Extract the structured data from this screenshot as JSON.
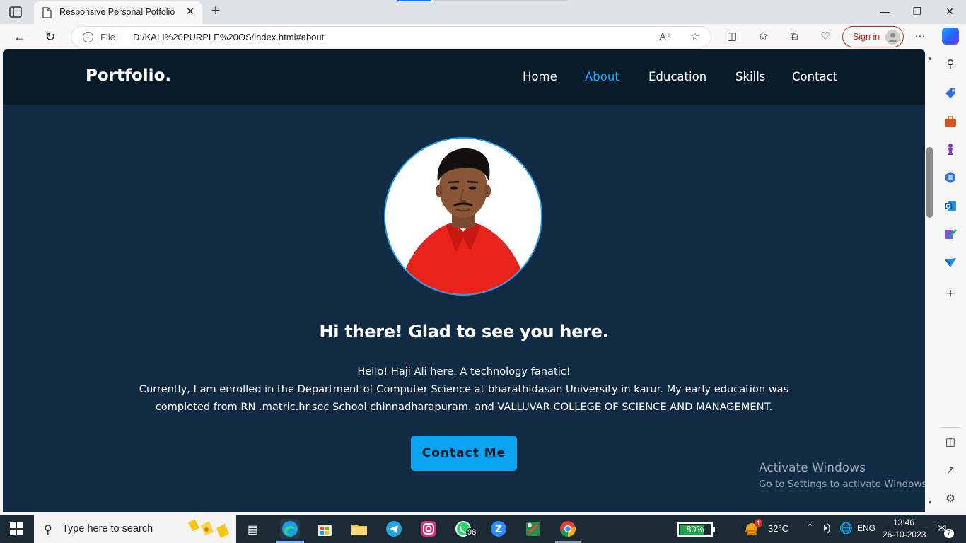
{
  "browser": {
    "tab_title": "Responsive Personal Potfolio",
    "tab_close": "✕",
    "new_tab": "+",
    "window_minimize": "—",
    "window_restore": "❐",
    "window_close": "✕",
    "address_scheme_label": "File",
    "url": "D:/KALI%20PURPLE%20OS/index.html#about",
    "sign_in_label": "Sign in",
    "more_menu": "⋯"
  },
  "site": {
    "logo": "Portfolio.",
    "nav": [
      {
        "label": "Home",
        "active": false
      },
      {
        "label": "About",
        "active": true
      },
      {
        "label": "Education",
        "active": false
      },
      {
        "label": "Skills",
        "active": false
      },
      {
        "label": "Contact",
        "active": false
      }
    ],
    "headline": "Hi there! Glad to see you here.",
    "intro_lines": [
      "Hello! Haji Ali here. A technology fanatic!",
      "Currently, I am enrolled in the Department of Computer Science at bharathidasan University in karur. My early education was",
      "completed from RN .matric.hr.sec School chinnadharapuram. and VALLUVAR COLLEGE OF SCIENCE AND MANAGEMENT."
    ],
    "cta_label": "Contact Me",
    "accent_color": "#1ea7ff",
    "header_bg": "#081b29",
    "body_bg": "#112b44"
  },
  "watermark": {
    "title": "Activate Windows",
    "subtitle": "Go to Settings to activate Windows."
  },
  "taskbar": {
    "search_placeholder": "Type here to search",
    "whatsapp_badge": "98",
    "battery_label": "80%",
    "battery_level": 0.8,
    "weather_badge": "1",
    "temperature": "32°C",
    "language": "ENG",
    "time": "13:46",
    "date": "26-10-2023",
    "notification_count": "7"
  }
}
